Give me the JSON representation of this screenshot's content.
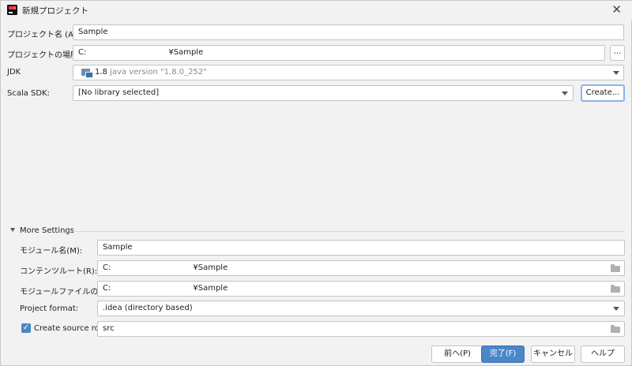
{
  "window": {
    "title": "新規プロジェクト",
    "close_glyph": "✕"
  },
  "project_name": {
    "label": "プロジェクト名 (A):",
    "value": "Sample"
  },
  "project_location": {
    "label": "プロジェクトの場所 (L):",
    "value_prefix": "C:",
    "value_suffix": "¥Sample",
    "browse_label": "..."
  },
  "jdk": {
    "label": "JDK",
    "version": "1.8",
    "detail": "java version \"1.8.0_252\""
  },
  "scala_sdk": {
    "label": "Scala SDK:",
    "value": "[No library selected]",
    "create_label": "Create..."
  },
  "more_settings": {
    "header": "More Settings",
    "module_name": {
      "label": "モジュール名(M):",
      "value": "Sample"
    },
    "content_root": {
      "label": "コンテンツルート(R):",
      "value_prefix": "C:",
      "value_suffix": "¥Sample"
    },
    "module_file_location": {
      "label": "モジュールファイルの場所(U):",
      "value_prefix": "C:",
      "value_suffix": "¥Sample"
    },
    "project_format": {
      "label": "Project format:",
      "value": ".idea (directory based)"
    },
    "create_source_root": {
      "label": "Create source root:",
      "checked": true,
      "value": "src"
    }
  },
  "footer": {
    "previous": "前へ(P)",
    "finish": "完了(F)",
    "cancel": "キャンセル",
    "help": "ヘルプ"
  },
  "colors": {
    "primary": "#4a86c8",
    "background": "#f2f2f2"
  }
}
